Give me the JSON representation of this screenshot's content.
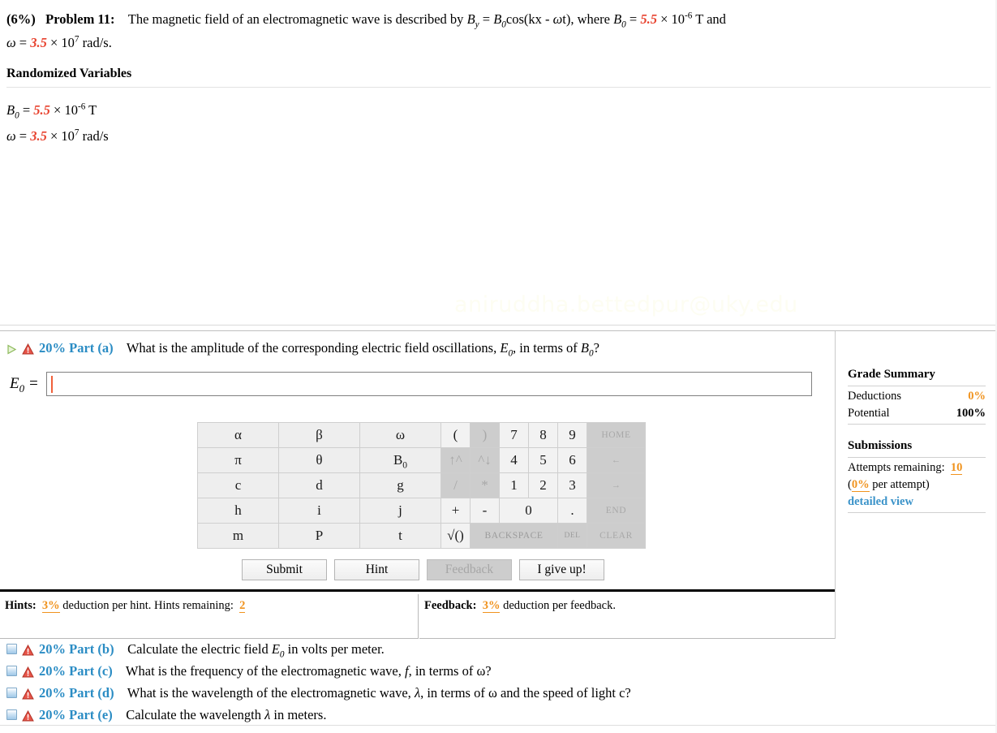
{
  "problem": {
    "weight": "(6%)",
    "number": "Problem 11:",
    "text_part1": "The magnetic field of an electromagnetic wave is described by ",
    "By": "B",
    "By_sub": "y",
    "eq_mid": " = ",
    "B0": "B",
    "B0_sub": "0",
    "cos_expr": "cos(kx - ",
    "omega_sym": "ω",
    "cos_tail": "t), where ",
    "B0_value": "5.5",
    "B0_mant": " × 10",
    "B0_exp": "-6",
    "B0_unit": " T and",
    "omega_label": "ω",
    "omega_eq": " = ",
    "omega_value": "3.5",
    "omega_mant": " × 10",
    "omega_exp": "7",
    "omega_unit": " rad/s."
  },
  "randomized": {
    "heading": "Randomized Variables",
    "vars": [
      {
        "name": "B",
        "sub": "0",
        "eq": " = ",
        "value": "5.5",
        "mant": " × 10",
        "exp": "-6",
        "unit": " T"
      },
      {
        "name": "ω",
        "sub": "",
        "eq": " = ",
        "value": "3.5",
        "mant": " × 10",
        "exp": "7",
        "unit": " rad/s"
      }
    ]
  },
  "watermark": "aniruddha.bettedpur@uky.edu",
  "part_a": {
    "label": "20% Part (a)",
    "question_pre": "What is the amplitude of the corresponding electric field oscillations, ",
    "E0": "E",
    "E0_sub": "0",
    "question_mid": ", in terms of ",
    "B0": "B",
    "B0_sub": "0",
    "question_end": "?",
    "answer_label_var": "E",
    "answer_label_sub": "0",
    "answer_label_eq": " =",
    "answer_value": "",
    "answer_placeholder": ""
  },
  "keypad": {
    "rows": [
      [
        {
          "l": "α",
          "t": "sym"
        },
        {
          "l": "β",
          "t": "sym"
        },
        {
          "l": "ω",
          "t": "sym"
        },
        {
          "l": "(",
          "t": "op"
        },
        {
          "l": ")",
          "t": "op dis"
        },
        {
          "l": "7",
          "t": "num"
        },
        {
          "l": "8",
          "t": "num"
        },
        {
          "l": "9",
          "t": "num"
        },
        {
          "l": "HOME",
          "t": "nav dis"
        }
      ],
      [
        {
          "l": "π",
          "t": "sym"
        },
        {
          "l": "θ",
          "t": "sym"
        },
        {
          "l": "B0",
          "t": "sym subscript"
        },
        {
          "l": "↑^",
          "t": "op dis"
        },
        {
          "l": "^↓",
          "t": "op dis"
        },
        {
          "l": "4",
          "t": "num"
        },
        {
          "l": "5",
          "t": "num"
        },
        {
          "l": "6",
          "t": "num"
        },
        {
          "l": "←",
          "t": "nav dis"
        }
      ],
      [
        {
          "l": "c",
          "t": "sym"
        },
        {
          "l": "d",
          "t": "sym"
        },
        {
          "l": "g",
          "t": "sym"
        },
        {
          "l": "/",
          "t": "op dis"
        },
        {
          "l": "*",
          "t": "op dis"
        },
        {
          "l": "1",
          "t": "num"
        },
        {
          "l": "2",
          "t": "num"
        },
        {
          "l": "3",
          "t": "num"
        },
        {
          "l": "→",
          "t": "nav dis"
        }
      ],
      [
        {
          "l": "h",
          "t": "sym"
        },
        {
          "l": "i",
          "t": "sym"
        },
        {
          "l": "j",
          "t": "sym"
        },
        {
          "l": "+",
          "t": "op"
        },
        {
          "l": "-",
          "t": "op"
        },
        {
          "l": "0",
          "t": "wide"
        },
        {
          "l": ".",
          "t": "num"
        },
        {
          "l": "END",
          "t": "nav dis"
        }
      ],
      [
        {
          "l": "m",
          "t": "sym"
        },
        {
          "l": "P",
          "t": "sym"
        },
        {
          "l": "t",
          "t": "sym"
        },
        {
          "l": "√()",
          "t": "op"
        },
        {
          "l": "BACKSPACE",
          "t": "wide-bs dis"
        },
        {
          "l": "DEL",
          "t": "del dis"
        },
        {
          "l": "CLEAR",
          "t": "nav dis"
        }
      ]
    ]
  },
  "actions": [
    {
      "label": "Submit",
      "disabled": false
    },
    {
      "label": "Hint",
      "disabled": false
    },
    {
      "label": "Feedback",
      "disabled": true
    },
    {
      "label": "I give up!",
      "disabled": false
    }
  ],
  "hints": {
    "title": "Hints:",
    "pct": "3%",
    "text": " deduction per hint. Hints remaining:",
    "remaining": "2"
  },
  "feedback": {
    "title": "Feedback:",
    "pct": "3%",
    "text": " deduction per feedback."
  },
  "grade": {
    "title": "Grade Summary",
    "deductions_label": "Deductions",
    "deductions_value": "0%",
    "potential_label": "Potential",
    "potential_value": "100%",
    "submissions_title": "Submissions",
    "attempts_label": "Attempts remaining:",
    "attempts_value": "10",
    "per_attempt_pct": "0%",
    "per_attempt_text": " per attempt)",
    "per_attempt_open": "(",
    "detailed_view": "detailed view"
  },
  "parts": [
    {
      "label": "20% Part (b)",
      "pre": "Calculate the electric field ",
      "var": "E",
      "var_sub": "0",
      "post": " in volts per meter."
    },
    {
      "label": "20% Part (c)",
      "pre": "What is the frequency of the electromagnetic wave, ",
      "var": "f",
      "var_sub": "",
      "post": ", in terms of ω?"
    },
    {
      "label": "20% Part (d)",
      "pre": "What is the wavelength of the electromagnetic wave, ",
      "var": "λ",
      "var_sub": "",
      "post": ", in terms of ω and the speed of light c?"
    },
    {
      "label": "20% Part (e)",
      "pre": "Calculate the wavelength ",
      "var": "λ",
      "var_sub": "",
      "post": " in meters."
    }
  ],
  "colors": {
    "part_label": "#2a8cc4",
    "accent_orange": "#f0931e",
    "randomized_red": "#e8422e",
    "link_blue": "#3b93c9",
    "caret": "#f0603a"
  }
}
